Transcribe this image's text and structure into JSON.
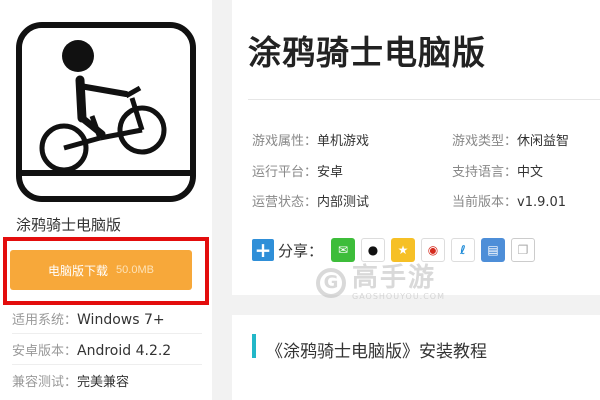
{
  "left": {
    "icon_name": "stick-figure-bike-icon",
    "title": "涂鸦骑士电脑版",
    "download_label": "电脑版下载",
    "download_size": "50.0MB",
    "info": [
      {
        "key": "适用系统：",
        "value": "Windows 7+"
      },
      {
        "key": "安卓版本：",
        "value": "Android 4.2.2"
      },
      {
        "key": "兼容测试：",
        "value": "完美兼容"
      }
    ]
  },
  "right": {
    "title": "涂鸦骑士电脑版",
    "attrs": [
      {
        "key": "游戏属性：",
        "value": "单机游戏"
      },
      {
        "key": "游戏类型：",
        "value": "休闲益智"
      },
      {
        "key": "运行平台：",
        "value": "安卓"
      },
      {
        "key": "支持语言：",
        "value": "中文"
      },
      {
        "key": "运营状态：",
        "value": "内部测试"
      },
      {
        "key": "当前版本：",
        "value": "v1.9.01"
      }
    ],
    "share_label": "分享：",
    "share_icons": [
      "wechat-icon",
      "qq-icon",
      "qzone-icon",
      "weibo-icon",
      "tencent-weibo-icon",
      "print-icon",
      "copy-icon"
    ]
  },
  "watermark": {
    "main": "高手游",
    "sub": "GAOSHOUYOU.COM"
  },
  "tutorial": {
    "title": "《涂鸦骑士电脑版》安装教程"
  },
  "colors": {
    "download": "#f7a83a",
    "highlight_frame": "#e30d0d",
    "accent_bar": "#22b7c8",
    "share_plus": "#2f8fd8"
  }
}
